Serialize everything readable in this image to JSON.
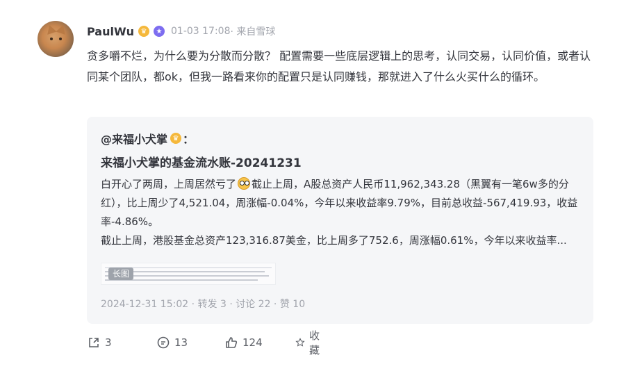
{
  "post": {
    "username": "PaulWu",
    "timestamp": "01-03 17:08",
    "source": "· 来自雪球",
    "body": "贪多嚼不烂，为什么要为分散而分散？ 配置需要一些底层逻辑上的思考，认同交易，认同价值，或者认同某个团队，都ok，但我一路看来你的配置只是认同赚钱，那就进入了什么火买什么的循环。"
  },
  "quote": {
    "author": "@来福小犬掌",
    "colon": "：",
    "title": "来福小犬掌的基金流水账-20241231",
    "line1a": "白开心了两周，上周居然亏了",
    "line1b": "截止上周，A股总资产人民币11,962,343.28（黑翼有一笔6w多的分红），比上周少了4,521.04，周涨幅-0.04%，今年以来收益率9.79%，目前总收益-567,419.93，收益率-4.86%。",
    "line2": "截止上周，港股基金总资产123,316.87美金，比上周多了752.6，周涨幅0.61%，今年以来收益率...",
    "image_tag": "长图",
    "footer": "2024-12-31 15:02 · 转发 3 · 讨论 22 · 赞 10"
  },
  "actions": {
    "share_count": "3",
    "comment_count": "13",
    "like_count": "124",
    "favorite_label": "收藏"
  }
}
